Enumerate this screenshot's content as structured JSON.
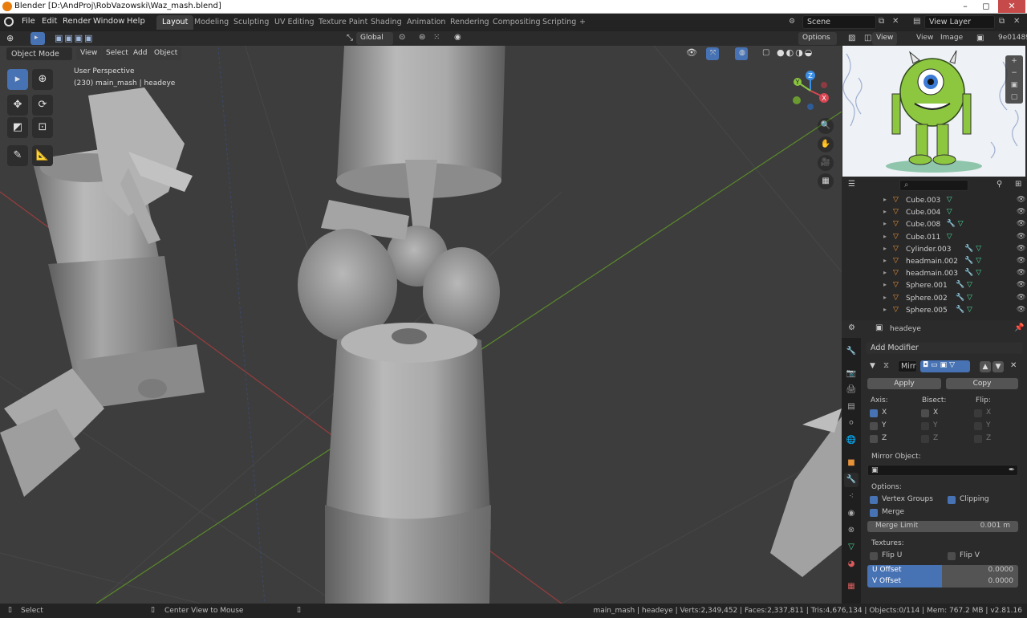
{
  "window": {
    "title": "Blender [D:\\AndProj\\RobVazowski\\Waz_mash.blend]",
    "minimize": "–",
    "maximize": "◻",
    "close": "✕"
  },
  "menu": {
    "items": [
      "File",
      "Edit",
      "Render",
      "Window",
      "Help"
    ]
  },
  "workspaces": [
    "Layout",
    "Modeling",
    "Sculpting",
    "UV Editing",
    "Texture Paint",
    "Shading",
    "Animation",
    "Rendering",
    "Compositing",
    "Scripting"
  ],
  "workspace_add": "+",
  "scene": {
    "label": "Scene",
    "view_layer": "View Layer"
  },
  "viewport": {
    "transform_orientation": "Global",
    "options": "Options",
    "mode": "Object Mode",
    "menus": [
      "View",
      "Select",
      "Add",
      "Object"
    ],
    "overlay_line1": "User Perspective",
    "overlay_line2": "(230) main_mash | headeye",
    "gizmo": {
      "z": "Z",
      "y": "Y",
      "x": "X"
    }
  },
  "image_editor": {
    "view": "View",
    "menus": [
      "View",
      "Image"
    ],
    "image_name": "9e01489"
  },
  "outliner": {
    "rows": [
      {
        "name": "Cube.003",
        "wrench": false
      },
      {
        "name": "Cube.004",
        "wrench": false
      },
      {
        "name": "Cube.008",
        "wrench": true
      },
      {
        "name": "Cube.011",
        "wrench": false
      },
      {
        "name": "Cylinder.003",
        "wrench": true
      },
      {
        "name": "headmain.002",
        "wrench": true
      },
      {
        "name": "headmain.003",
        "wrench": true
      },
      {
        "name": "Sphere.001",
        "wrench": true
      },
      {
        "name": "Sphere.002",
        "wrench": true
      },
      {
        "name": "Sphere.005",
        "wrench": true
      }
    ]
  },
  "properties": {
    "object_name": "headeye",
    "add_modifier": "Add Modifier",
    "modifier_name": "Mirr",
    "apply": "Apply",
    "copy": "Copy",
    "axis_label": "Axis:",
    "bisect_label": "Bisect:",
    "flip_label": "Flip:",
    "axes": [
      "X",
      "Y",
      "Z"
    ],
    "mirror_object_label": "Mirror Object:",
    "options_label": "Options:",
    "vertex_groups": "Vertex Groups",
    "clipping": "Clipping",
    "merge": "Merge",
    "merge_limit_label": "Merge Limit",
    "merge_limit_value": "0.001 m",
    "textures_label": "Textures:",
    "flip_u": "Flip U",
    "flip_v": "Flip V",
    "u_offset_label": "U Offset",
    "u_offset_value": "0.0000",
    "v_offset_label": "V Offset",
    "v_offset_value": "0.0000"
  },
  "status": {
    "select": "Select",
    "center_view": "Center View to Mouse",
    "info": "main_mash | headeye | Verts:2,349,452 | Faces:2,337,811 | Tris:4,676,134 | Objects:0/114 | Mem: 767.2 MB | v2.81.16"
  },
  "colors": {
    "accent": "#4772b3",
    "x_axis": "#d94552",
    "y_axis": "#8bc53f",
    "z_axis": "#3b8ee5"
  }
}
